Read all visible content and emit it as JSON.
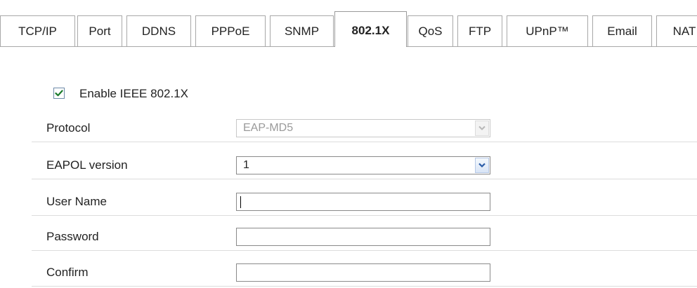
{
  "tabs": [
    {
      "label": "TCP/IP",
      "active": false
    },
    {
      "label": "Port",
      "active": false
    },
    {
      "label": "DDNS",
      "active": false
    },
    {
      "label": "PPPoE",
      "active": false
    },
    {
      "label": "SNMP",
      "active": false
    },
    {
      "label": "802.1X",
      "active": true
    },
    {
      "label": "QoS",
      "active": false
    },
    {
      "label": "FTP",
      "active": false
    },
    {
      "label": "UPnP™",
      "active": false
    },
    {
      "label": "Email",
      "active": false
    },
    {
      "label": "NAT",
      "active": false
    }
  ],
  "enable": {
    "label": "Enable IEEE 802.1X",
    "checked": true
  },
  "form": {
    "protocol": {
      "label": "Protocol",
      "value": "EAP-MD5",
      "disabled": true
    },
    "eapol_version": {
      "label": "EAPOL version",
      "value": "1"
    },
    "user_name": {
      "label": "User Name",
      "value": ""
    },
    "password": {
      "label": "Password",
      "value": ""
    },
    "confirm": {
      "label": "Confirm",
      "value": ""
    }
  },
  "colors": {
    "check": "#1a7a2b",
    "dropdown_arrow": "#2a5ca8"
  }
}
